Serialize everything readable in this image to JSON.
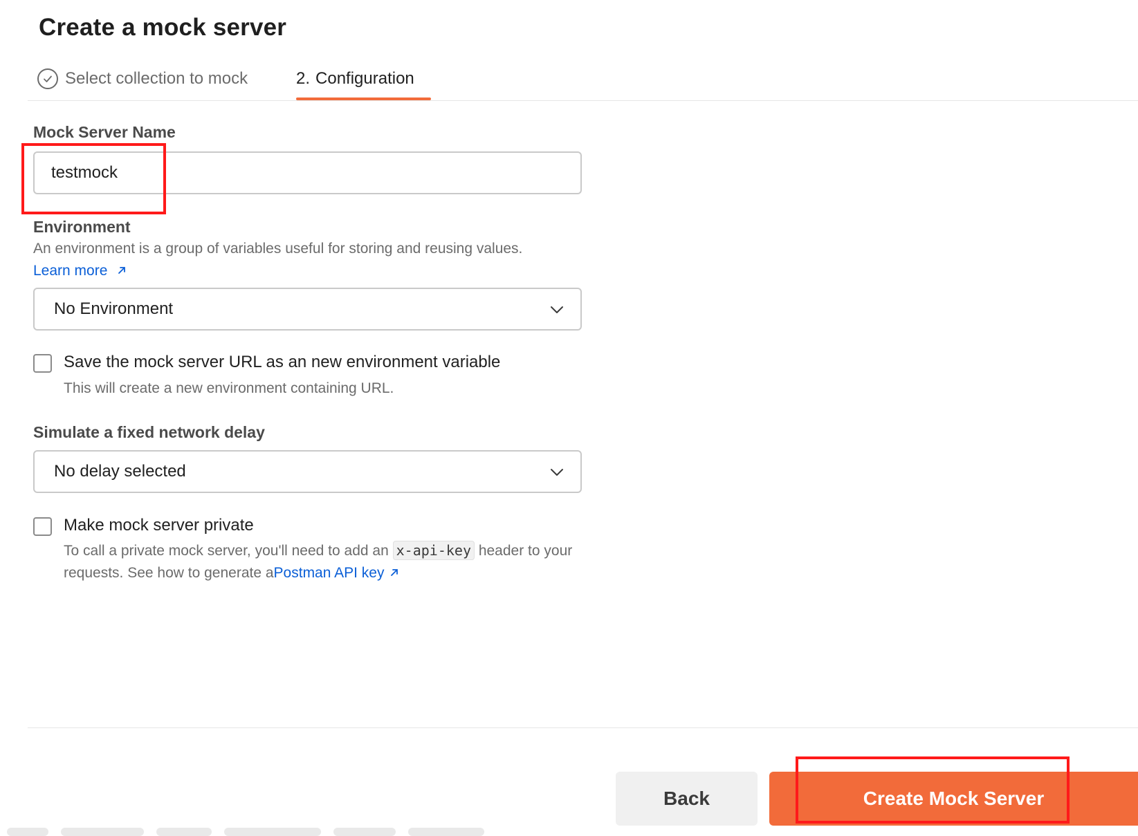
{
  "header": {
    "title": "Create a mock server"
  },
  "stepper": {
    "step1_label": "Select collection to mock",
    "step2_number": "2.",
    "step2_label": "Configuration"
  },
  "form": {
    "name_label": "Mock Server Name",
    "name_value": "testmock",
    "environment_label": "Environment",
    "environment_desc": "An environment is a group of variables useful for storing and reusing values.",
    "learn_more": "Learn more",
    "environment_selected": "No Environment",
    "save_url_label": "Save the mock server URL as an new environment variable",
    "save_url_help": "This will create a new environment containing URL.",
    "delay_label": "Simulate a fixed network delay",
    "delay_selected": "No delay selected",
    "private_label": "Make mock server private",
    "private_help_1": "To call a private mock server, you'll need to add an ",
    "private_help_code": "x-api-key",
    "private_help_2": " header to your requests. See how to generate a",
    "private_help_link": "Postman API key"
  },
  "footer": {
    "back_label": "Back",
    "create_label": "Create Mock Server"
  },
  "colors": {
    "accent": "#f26b3a",
    "link": "#0b5fd7",
    "annotation": "#ff1a1a"
  },
  "icons": {
    "step1": "check-circle-icon",
    "external": "external-link-icon",
    "dropdown": "chevron-down-icon"
  }
}
